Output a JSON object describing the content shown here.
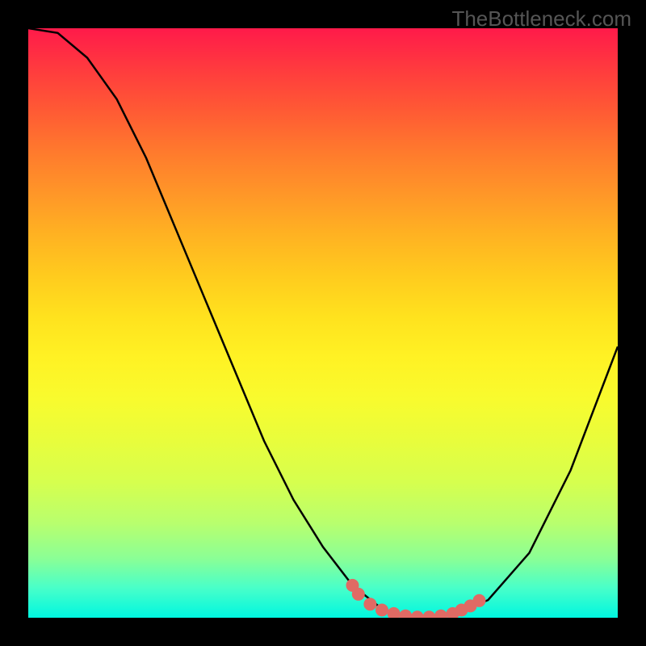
{
  "watermark": "TheBottleneck.com",
  "chart_data": {
    "type": "line",
    "title": "",
    "xlabel": "",
    "ylabel": "",
    "xlim": [
      0,
      100
    ],
    "ylim": [
      0,
      100
    ],
    "curve": {
      "name": "bottleneck-curve",
      "x": [
        0,
        5,
        10,
        15,
        20,
        25,
        30,
        35,
        40,
        45,
        50,
        55,
        60,
        62,
        65,
        68,
        72,
        78,
        85,
        92,
        100
      ],
      "y": [
        100,
        99.2,
        95,
        88,
        78,
        66,
        54,
        42,
        30,
        20,
        12,
        5.5,
        1.5,
        0.5,
        0,
        0,
        0.5,
        3,
        11,
        25,
        46
      ]
    },
    "scatter_overlay": {
      "name": "highlight-dots",
      "color": "#e06a64",
      "points": [
        {
          "x": 55,
          "y": 5.5
        },
        {
          "x": 56,
          "y": 4.0
        },
        {
          "x": 58,
          "y": 2.3
        },
        {
          "x": 60,
          "y": 1.3
        },
        {
          "x": 62,
          "y": 0.7
        },
        {
          "x": 64,
          "y": 0.3
        },
        {
          "x": 66,
          "y": 0.1
        },
        {
          "x": 68,
          "y": 0.1
        },
        {
          "x": 70,
          "y": 0.3
        },
        {
          "x": 72,
          "y": 0.7
        },
        {
          "x": 73.5,
          "y": 1.3
        },
        {
          "x": 75,
          "y": 2.0
        },
        {
          "x": 76.5,
          "y": 2.9
        }
      ]
    },
    "gradient_colors": {
      "top": "#ff1a4a",
      "bottom": "#00f6e0"
    }
  }
}
